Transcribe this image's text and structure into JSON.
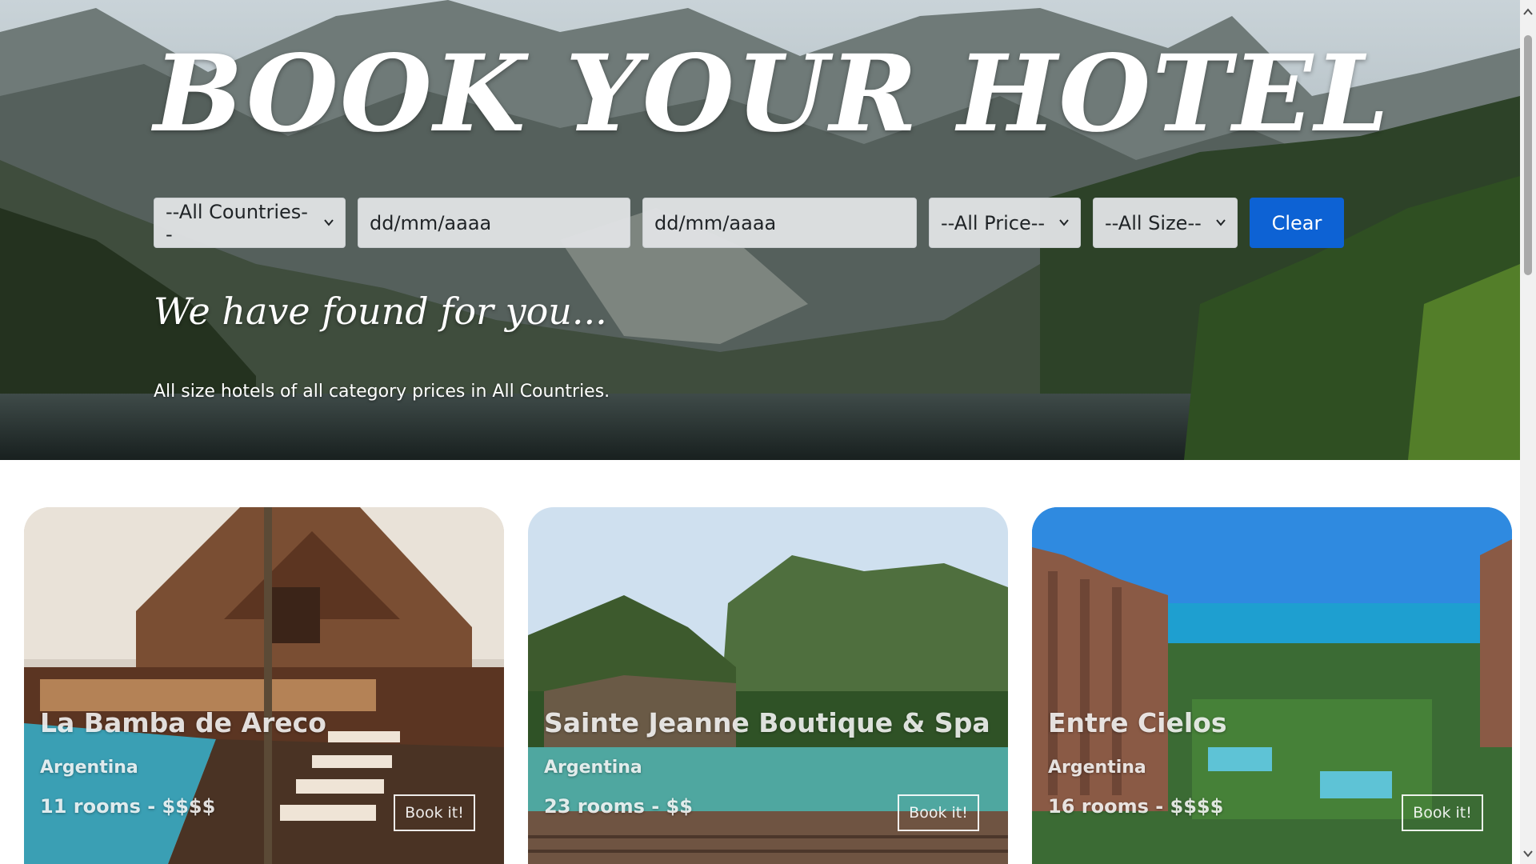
{
  "hero": {
    "title": "BOOK YOUR HOTEL",
    "subtitle": "We have found for you...",
    "summary": "All size hotels of all category prices in All Countries."
  },
  "filters": {
    "country": "--All Countries--",
    "date_from_placeholder": "dd/mm/aaaa",
    "date_to_placeholder": "dd/mm/aaaa",
    "price": "--All Price--",
    "size": "--All Size--",
    "clear_label": "Clear"
  },
  "hotels": [
    {
      "name": "La Bamba de Areco",
      "country": "Argentina",
      "meta": "11 rooms - $$$$",
      "button": "Book it!"
    },
    {
      "name": "Sainte Jeanne Boutique & Spa",
      "country": "Argentina",
      "meta": "23 rooms - $$",
      "button": "Book it!"
    },
    {
      "name": "Entre Cielos",
      "country": "Argentina",
      "meta": "16 rooms - $$$$",
      "button": "Book it!"
    }
  ],
  "colors": {
    "accent": "#0d62d4",
    "field_bg": "#e0e2e4"
  },
  "icons": {
    "chevron": "chevron-down-icon",
    "scroll_up": "scroll-up-arrow-icon",
    "scroll_down": "scroll-down-arrow-icon"
  }
}
